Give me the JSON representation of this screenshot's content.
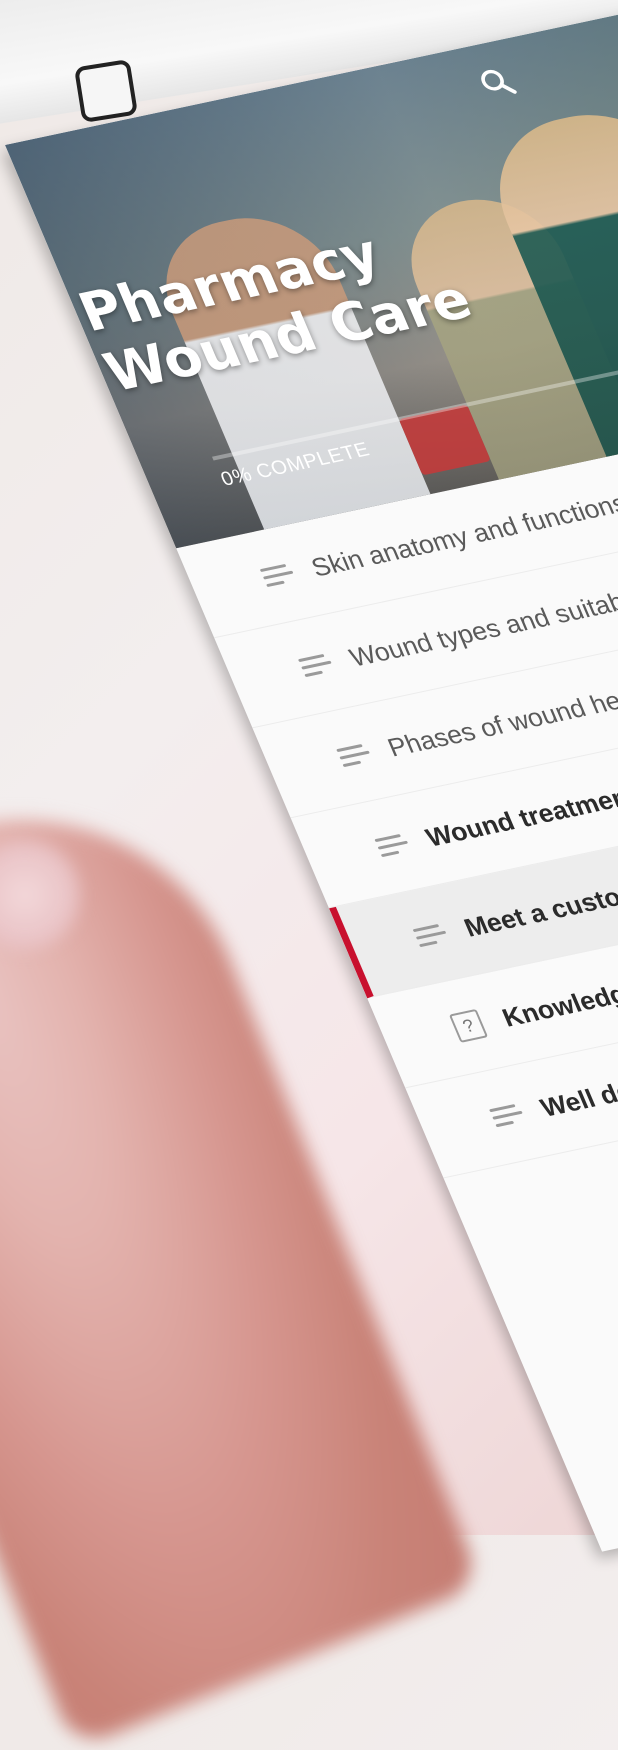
{
  "course": {
    "title_line1": "Pharmacy",
    "title_line2": "Wound Care",
    "progress_percent": 0,
    "progress_label": "0% COMPLETE"
  },
  "lessons": [
    {
      "label": "Skin anatomy and functions",
      "icon": "list-icon",
      "status": "incomplete"
    },
    {
      "label": "Wound types and suitable products",
      "icon": "list-icon",
      "status": "incomplete"
    },
    {
      "label": "Phases of wound healing",
      "icon": "list-icon"
    },
    {
      "label": "Wound treatment and barriers to healing",
      "icon": "list-icon"
    },
    {
      "label": "Meet a customer",
      "icon": "list-icon",
      "active": true
    },
    {
      "label": "Knowledge test",
      "icon": "question-icon"
    },
    {
      "label": "Well done",
      "icon": "list-icon"
    }
  ],
  "colors": {
    "accent": "#c8102e"
  }
}
